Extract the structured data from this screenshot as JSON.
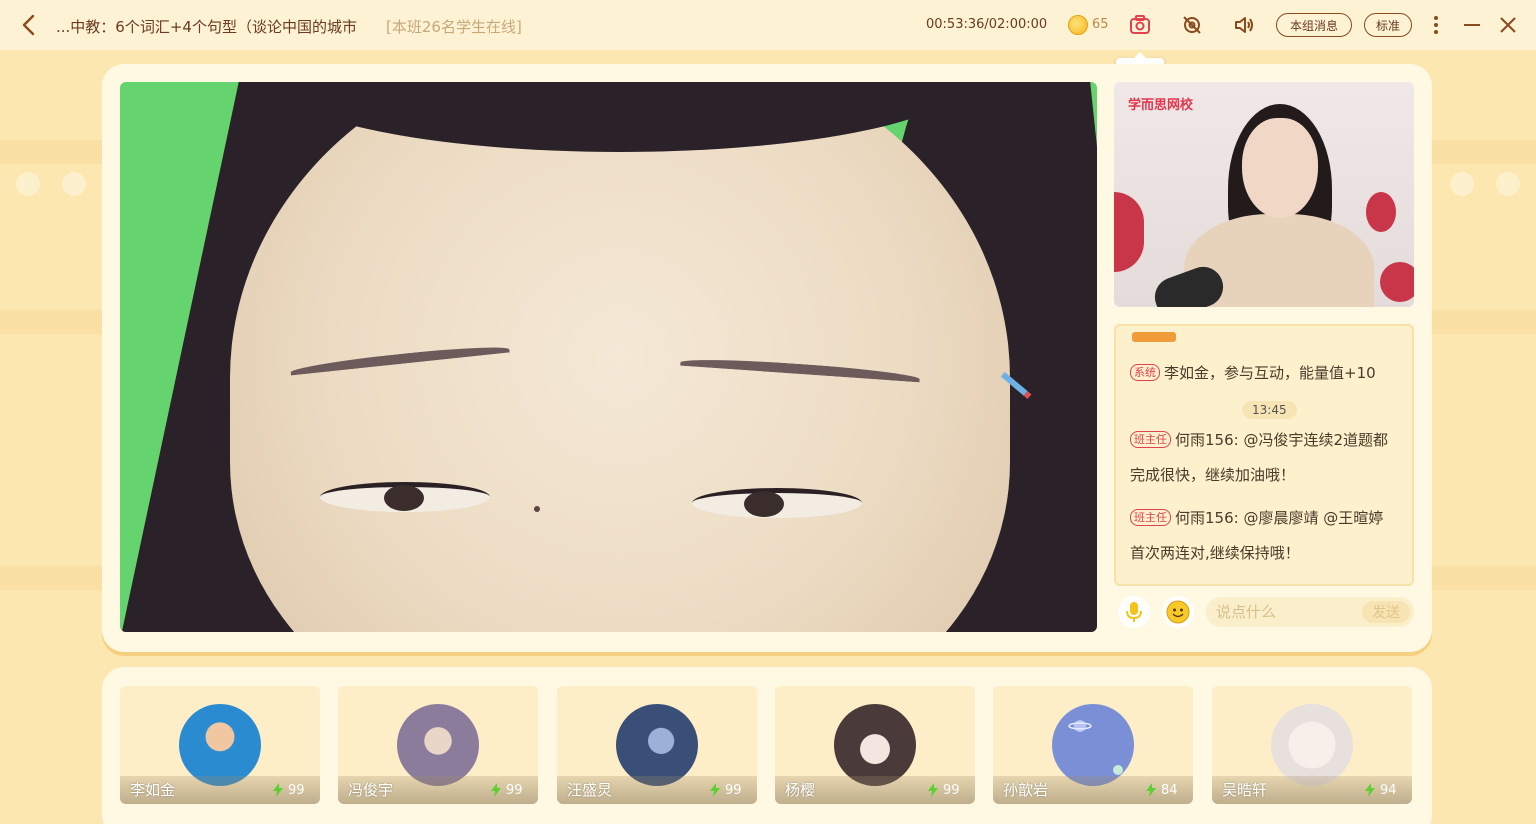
{
  "header": {
    "title": "...中教：6个词汇+4个句型（谈论中国的城市",
    "online_text": "[本班26名学生在线]",
    "timer": "00:53:36/02:00:00",
    "coins": "65",
    "group_msg_label": "本组消息",
    "quality_label": "标准",
    "screenshot_tooltip": "截屏"
  },
  "teacher_video": {
    "school_logo": "学而思网校"
  },
  "chat": {
    "messages": [
      {
        "tag": "系统",
        "text": "李如金，参与互动，能量值+10"
      },
      {
        "time": "13:45"
      },
      {
        "tag": "班主任",
        "line1": "何雨156: @冯俊宇连续2道题都",
        "line2": "完成很快，继续加油哦！"
      },
      {
        "tag": "班主任",
        "line1": "何雨156: @廖晨廖靖 @王暄婷",
        "line2": "首次两连对,继续保持哦！"
      }
    ],
    "input_placeholder": "说点什么",
    "send_label": "发送"
  },
  "students": [
    {
      "name": "李如金",
      "energy": "99",
      "avatar_color": "#2a8bd0"
    },
    {
      "name": "冯俊宇",
      "energy": "99",
      "avatar_color": "#8c7c9c"
    },
    {
      "name": "汪盛炅",
      "energy": "99",
      "avatar_color": "#3a4f78"
    },
    {
      "name": "杨樱",
      "energy": "99",
      "avatar_color": "#4a3a3a"
    },
    {
      "name": "孙歆岩",
      "energy": "84",
      "avatar_color": "#7b8fd6"
    },
    {
      "name": "吴晧轩",
      "energy": "94",
      "avatar_color": "#e8e0dc"
    }
  ],
  "colors": {
    "accent": "#e0424e",
    "header_text": "#6b3a1f",
    "background": "#fde7b0"
  }
}
